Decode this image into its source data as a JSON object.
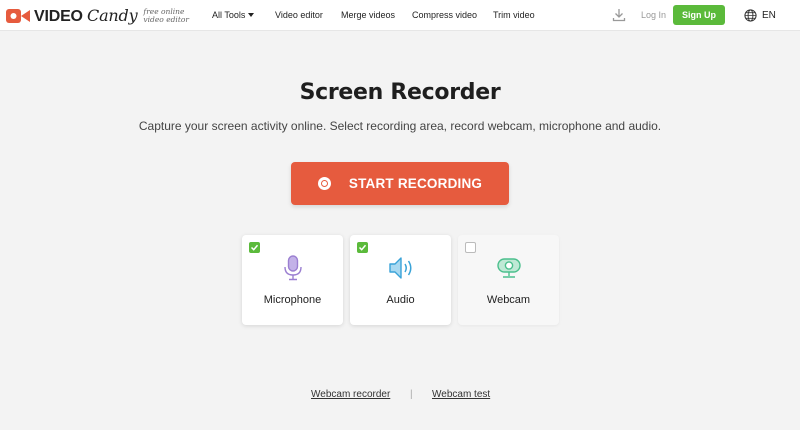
{
  "brand": {
    "name_part1": "VIDEO",
    "name_part2": "Candy",
    "tagline": "free online video editor",
    "accent_color": "#e65b3e"
  },
  "nav": {
    "items": [
      {
        "label": "All Tools",
        "has_dropdown": true
      },
      {
        "label": "Video editor"
      },
      {
        "label": "Merge videos"
      },
      {
        "label": "Compress video"
      },
      {
        "label": "Trim video"
      }
    ],
    "login_label": "Log In",
    "signup_label": "Sign Up",
    "signup_color": "#5bba3b",
    "language": "EN",
    "icons": [
      "download-icon",
      "globe-icon"
    ]
  },
  "main": {
    "title": "Screen Recorder",
    "subtitle": "Capture your screen activity online. Select recording area, record webcam, microphone and audio.",
    "start_button_label": "START RECORDING",
    "options": [
      {
        "label": "Microphone",
        "checked": true,
        "icon": "microphone-icon",
        "icon_color": "#9b7fd1"
      },
      {
        "label": "Audio",
        "checked": true,
        "icon": "speaker-icon",
        "icon_color": "#3aa3d8"
      },
      {
        "label": "Webcam",
        "checked": false,
        "icon": "webcam-icon",
        "icon_color": "#4cbf8d"
      }
    ]
  },
  "footer": {
    "links": [
      "Webcam recorder",
      "Webcam test"
    ],
    "separator": "|"
  }
}
